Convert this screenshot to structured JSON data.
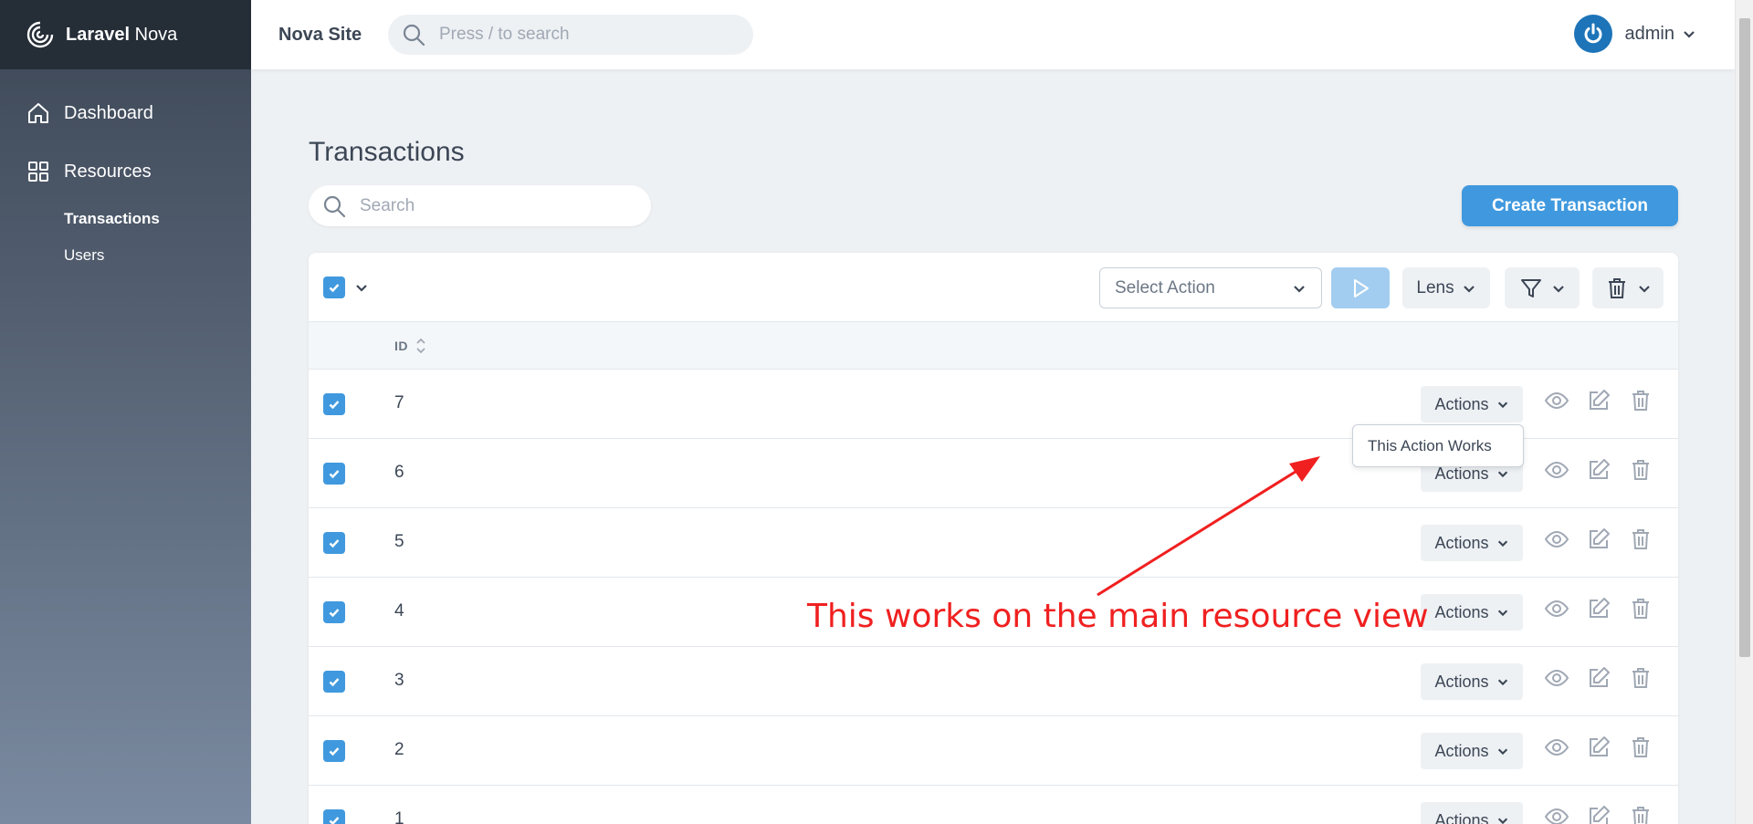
{
  "brand": {
    "bold": "Laravel",
    "rest": " Nova"
  },
  "sidebar": {
    "dashboard": "Dashboard",
    "resources": "Resources",
    "items": [
      "Transactions",
      "Users"
    ]
  },
  "topbar": {
    "site_name": "Nova Site",
    "search_placeholder": "Press / to search",
    "user_name": "admin"
  },
  "main": {
    "title": "Transactions",
    "search_placeholder": "Search",
    "create_label": "Create Transaction",
    "select_action": "Select Action",
    "lens_label": "Lens",
    "id_header": "ID",
    "actions_label": "Actions",
    "rows": [
      "7",
      "6",
      "5",
      "4",
      "3",
      "2",
      "1"
    ]
  },
  "popup": {
    "item": "This Action Works"
  },
  "annotation": {
    "text": "This works on the main resource view"
  },
  "colors": {
    "primary": "#4099de",
    "sidebar_top": "#252d37",
    "annotation": "#f02020"
  }
}
